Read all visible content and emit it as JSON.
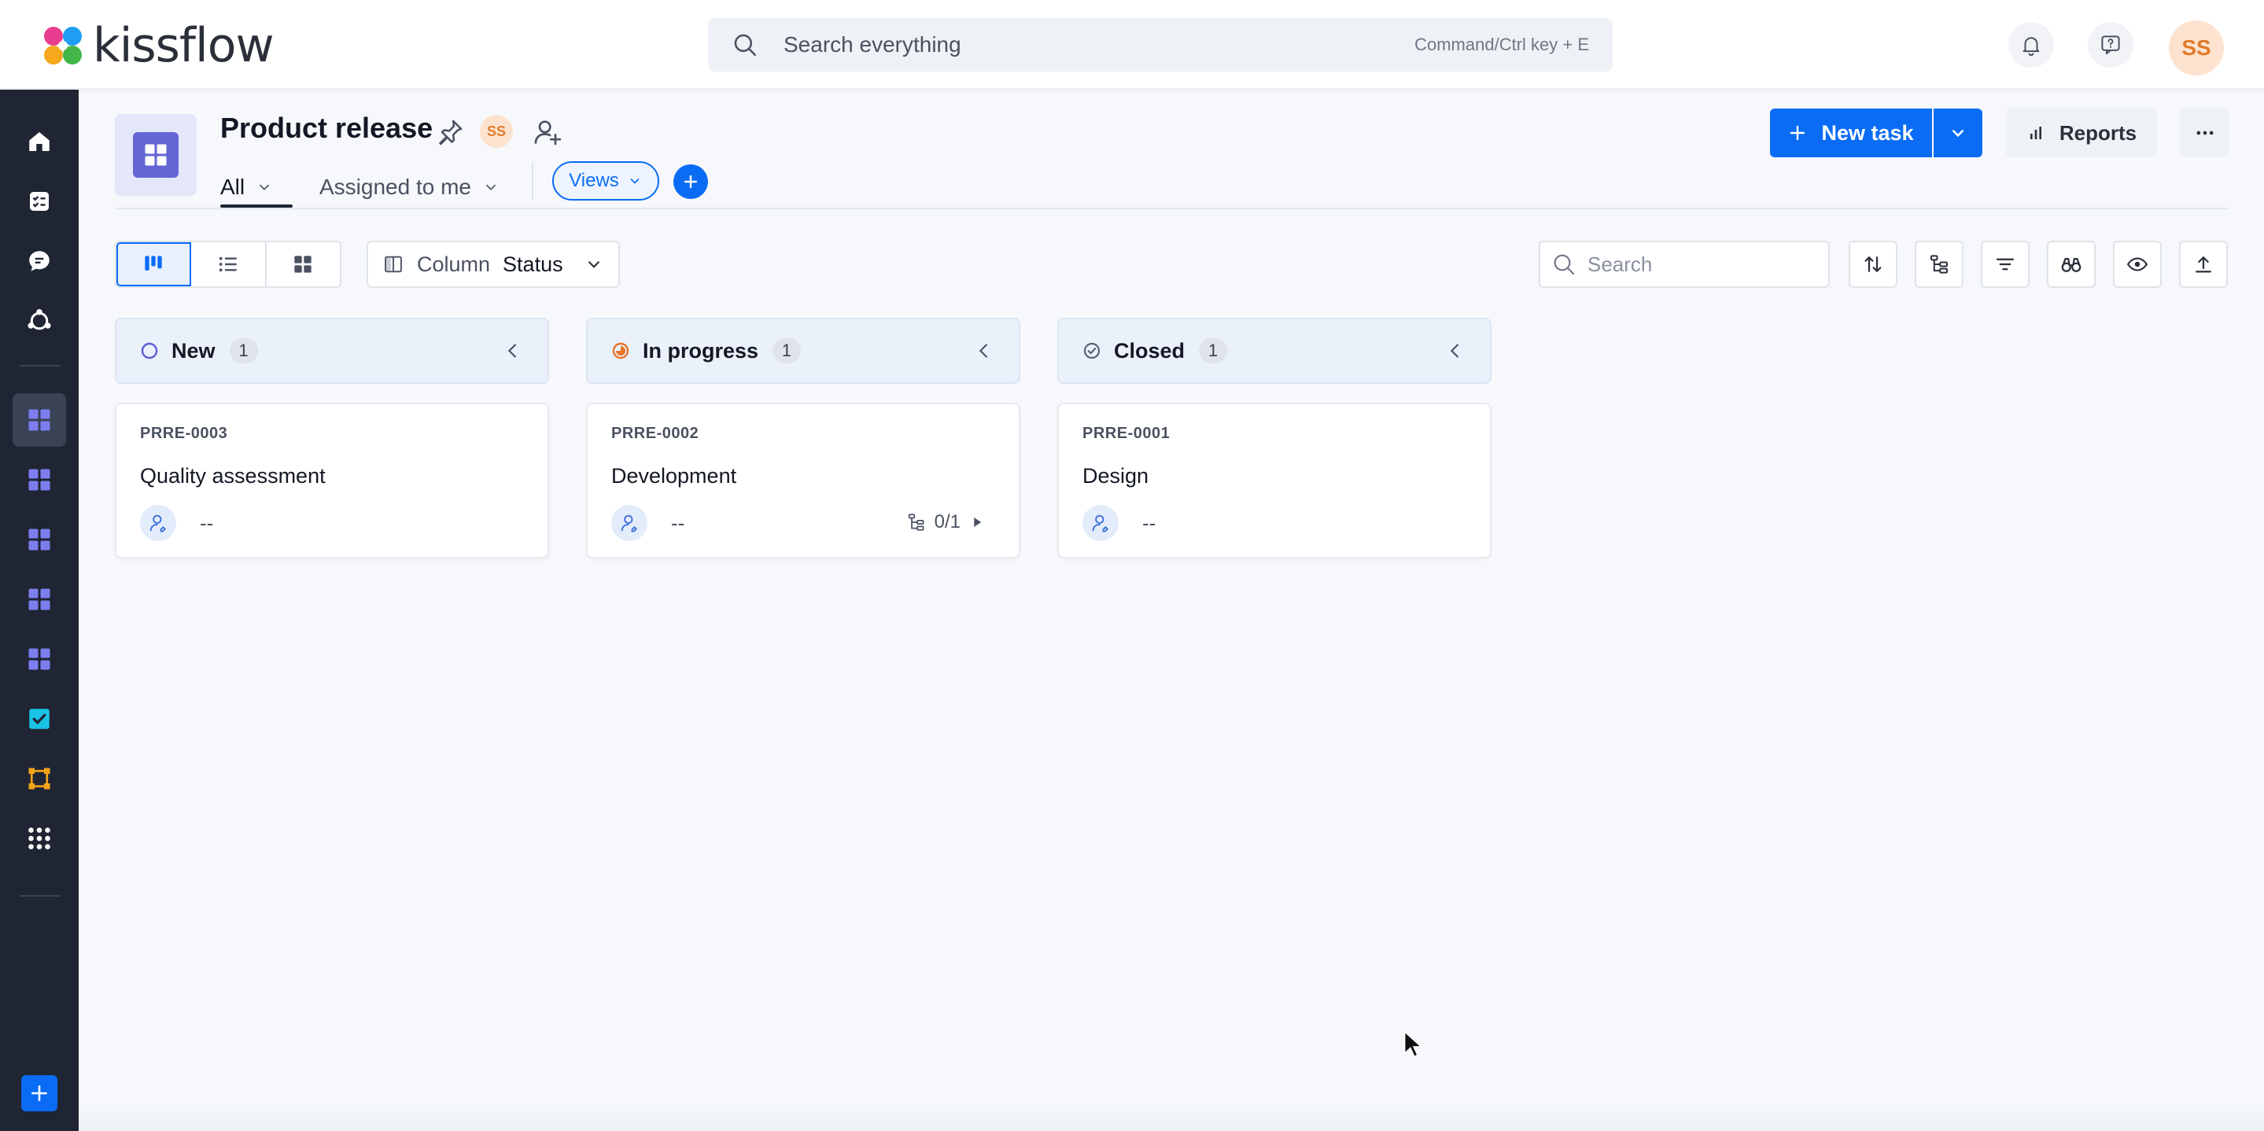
{
  "app": {
    "logo_text": "kissflow",
    "search_placeholder": "Search everything",
    "search_hint": "Command/Ctrl key + E",
    "user_initials": "SS",
    "colors": {
      "accent": "#0a6cf5",
      "sidebar": "#1f2533",
      "board_icon": "#6466d6"
    }
  },
  "sidebar": {
    "items": [
      {
        "name": "home-icon"
      },
      {
        "name": "my-tasks-icon"
      },
      {
        "name": "chat-icon"
      },
      {
        "name": "community-icon"
      },
      {
        "name": "board-icon",
        "active": true
      },
      {
        "name": "board-icon"
      },
      {
        "name": "board-icon"
      },
      {
        "name": "board-icon"
      },
      {
        "name": "board-icon"
      },
      {
        "name": "checklist-icon"
      },
      {
        "name": "process-icon"
      },
      {
        "name": "all-apps-icon"
      }
    ]
  },
  "board": {
    "title": "Product release",
    "owner_initials": "SS",
    "tabs": [
      {
        "label": "All",
        "active": true
      },
      {
        "label": "Assigned to me"
      }
    ],
    "views_label": "Views",
    "new_task_label": "New task",
    "reports_label": "Reports"
  },
  "toolbar": {
    "column_label": "Column",
    "column_value": "Status",
    "search_placeholder": "Search"
  },
  "columns": [
    {
      "name": "New",
      "count": "1",
      "status_color": "#5b5fd6",
      "cards": [
        {
          "code": "PRRE-0003",
          "title": "Quality assessment",
          "assignee": "--"
        }
      ]
    },
    {
      "name": "In progress",
      "count": "1",
      "status_color": "#e8752a",
      "cards": [
        {
          "code": "PRRE-0002",
          "title": "Development",
          "assignee": "--",
          "subtasks": "0/1"
        }
      ]
    },
    {
      "name": "Closed",
      "count": "1",
      "status_color": "#5b6270",
      "cards": [
        {
          "code": "PRRE-0001",
          "title": "Design",
          "assignee": "--"
        }
      ]
    }
  ]
}
